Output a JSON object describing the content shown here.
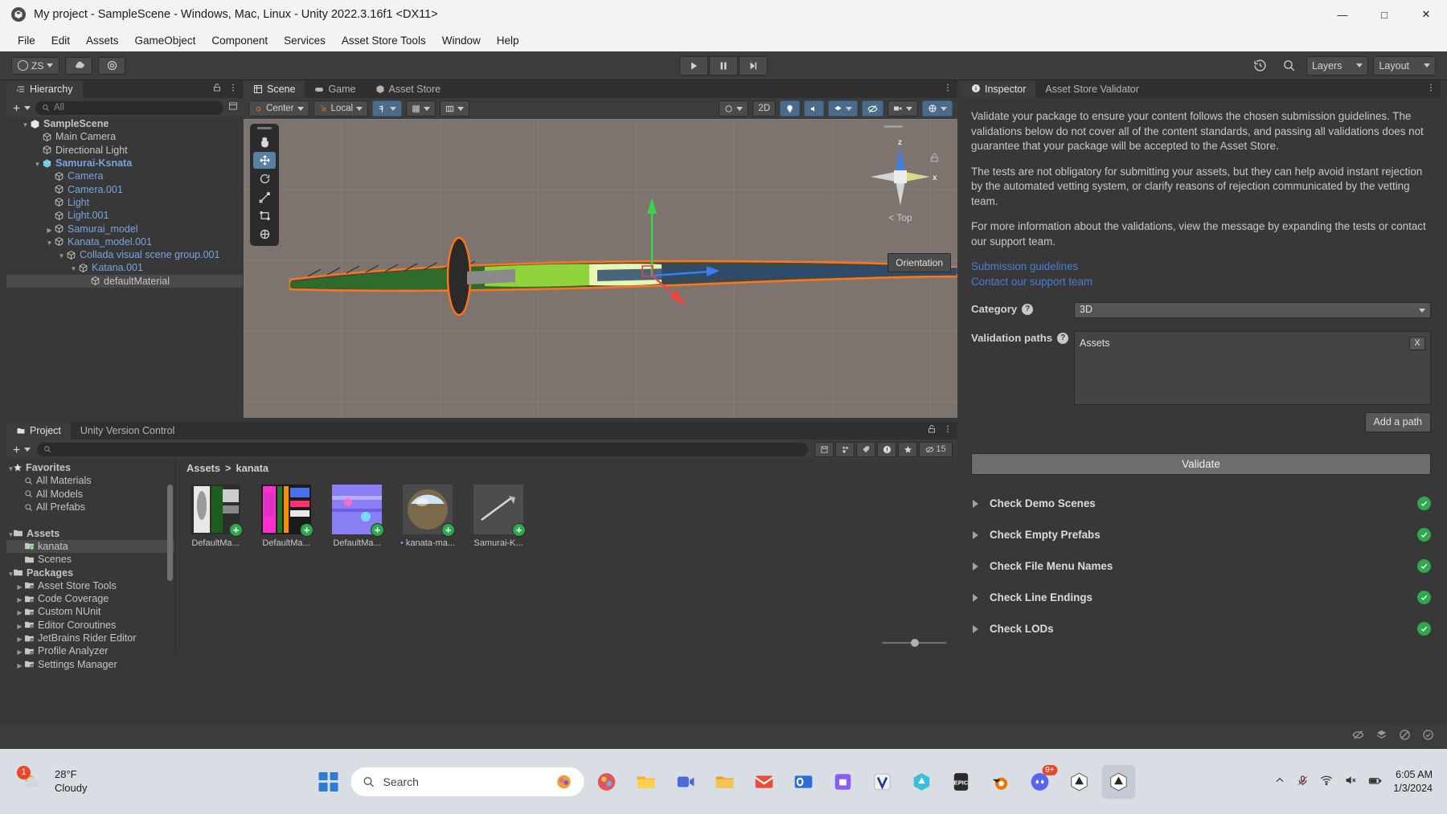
{
  "window": {
    "title": "My project - SampleScene - Windows, Mac, Linux - Unity 2022.3.16f1 <DX11>",
    "minimize": "—",
    "maximize": "□",
    "close": "✕"
  },
  "menubar": {
    "items": [
      "File",
      "Edit",
      "Assets",
      "GameObject",
      "Component",
      "Services",
      "Asset Store Tools",
      "Window",
      "Help"
    ]
  },
  "toolbar": {
    "account": "ZS",
    "layers_label": "Layers",
    "layout_label": "Layout"
  },
  "hierarchy": {
    "tab": "Hierarchy",
    "search_placeholder": "All",
    "rows": [
      {
        "label": "SampleScene",
        "depth": 1,
        "tri": "down",
        "bold": true,
        "blue": false,
        "selected": false
      },
      {
        "label": "Main Camera",
        "depth": 2,
        "tri": "",
        "bold": false,
        "blue": false,
        "selected": false
      },
      {
        "label": "Directional Light",
        "depth": 2,
        "tri": "",
        "bold": false,
        "blue": false,
        "selected": false
      },
      {
        "label": "Samurai-Ksnata",
        "depth": 2,
        "tri": "down",
        "bold": true,
        "blue": true,
        "selected": false
      },
      {
        "label": "Camera",
        "depth": 3,
        "tri": "",
        "bold": false,
        "blue": true,
        "selected": false
      },
      {
        "label": "Camera.001",
        "depth": 3,
        "tri": "",
        "bold": false,
        "blue": true,
        "selected": false
      },
      {
        "label": "Light",
        "depth": 3,
        "tri": "",
        "bold": false,
        "blue": true,
        "selected": false
      },
      {
        "label": "Light.001",
        "depth": 3,
        "tri": "",
        "bold": false,
        "blue": true,
        "selected": false
      },
      {
        "label": "Samurai_model",
        "depth": 3,
        "tri": "right",
        "bold": false,
        "blue": true,
        "selected": false
      },
      {
        "label": "Kanata_model.001",
        "depth": 3,
        "tri": "down",
        "bold": false,
        "blue": true,
        "selected": false
      },
      {
        "label": "Collada visual scene group.001",
        "depth": 4,
        "tri": "down",
        "bold": false,
        "blue": true,
        "selected": false
      },
      {
        "label": "Katana.001",
        "depth": 5,
        "tri": "down",
        "bold": false,
        "blue": true,
        "selected": false
      },
      {
        "label": "defaultMaterial",
        "depth": 6,
        "tri": "",
        "bold": false,
        "blue": false,
        "selected": true
      }
    ]
  },
  "scene": {
    "tabs": [
      {
        "label": "Scene",
        "active": true
      },
      {
        "label": "Game",
        "active": false
      },
      {
        "label": "Asset Store",
        "active": false
      }
    ],
    "pivot_mode": "Center",
    "pivot_rotation": "Local",
    "view_2d": "2D",
    "gizmo_axis_z": "z",
    "gizmo_axis_x": "x",
    "gizmo_view_label": "Top",
    "orientation_tooltip": "Orientation"
  },
  "inspector": {
    "tabs": [
      {
        "label": "Inspector",
        "active": true
      },
      {
        "label": "Asset Store Validator",
        "active": false
      }
    ],
    "paragraphs": [
      "Validate your package to ensure your content follows the chosen submission guidelines. The validations below do not cover all of the content standards, and passing all validations does not guarantee that your package will be accepted to the Asset Store.",
      "The tests are not obligatory for submitting your assets, but they can help avoid instant rejection by the automated vetting system, or clarify reasons of rejection communicated by the vetting team.",
      "For more information about the validations, view the message by expanding the tests or contact our support team."
    ],
    "links": [
      "Submission guidelines",
      "Contact our support team"
    ],
    "category_label": "Category",
    "category_value": "3D",
    "validation_paths_label": "Validation paths",
    "validation_path_value": "Assets",
    "remove_path_label": "X",
    "add_path_label": "Add a path",
    "validate_label": "Validate",
    "checks": [
      {
        "label": "Check Demo Scenes",
        "status": "pass"
      },
      {
        "label": "Check Empty Prefabs",
        "status": "pass"
      },
      {
        "label": "Check File Menu Names",
        "status": "pass"
      },
      {
        "label": "Check Line Endings",
        "status": "pass"
      },
      {
        "label": "Check LODs",
        "status": "pass"
      }
    ],
    "tick_glyph": "✓"
  },
  "project": {
    "tabs": [
      {
        "label": "Project",
        "active": true
      },
      {
        "label": "Unity Version Control",
        "active": false
      }
    ],
    "hidden_count": "15",
    "breadcrumb": [
      "Assets",
      "kanata"
    ],
    "tree": [
      {
        "label": "Favorites",
        "depth": 0,
        "tri": "down",
        "bold": true,
        "icon": "star",
        "selected": false
      },
      {
        "label": "All Materials",
        "depth": 1,
        "tri": "",
        "bold": false,
        "icon": "search",
        "selected": false
      },
      {
        "label": "All Models",
        "depth": 1,
        "tri": "",
        "bold": false,
        "icon": "search",
        "selected": false
      },
      {
        "label": "All Prefabs",
        "depth": 1,
        "tri": "",
        "bold": false,
        "icon": "search",
        "selected": false
      },
      {
        "label": "",
        "depth": 0,
        "tri": "",
        "bold": false,
        "icon": "",
        "selected": false
      },
      {
        "label": "Assets",
        "depth": 0,
        "tri": "down",
        "bold": true,
        "icon": "folder",
        "selected": false
      },
      {
        "label": "kanata",
        "depth": 1,
        "tri": "",
        "bold": false,
        "icon": "folder-add",
        "selected": true
      },
      {
        "label": "Scenes",
        "depth": 1,
        "tri": "",
        "bold": false,
        "icon": "folder",
        "selected": false
      },
      {
        "label": "Packages",
        "depth": 0,
        "tri": "down",
        "bold": true,
        "icon": "folder",
        "selected": false
      },
      {
        "label": "Asset Store Tools",
        "depth": 1,
        "tri": "right",
        "bold": false,
        "icon": "folder-pkg",
        "selected": false
      },
      {
        "label": "Code Coverage",
        "depth": 1,
        "tri": "right",
        "bold": false,
        "icon": "folder-pkg",
        "selected": false
      },
      {
        "label": "Custom NUnit",
        "depth": 1,
        "tri": "right",
        "bold": false,
        "icon": "folder-pkg",
        "selected": false
      },
      {
        "label": "Editor Coroutines",
        "depth": 1,
        "tri": "right",
        "bold": false,
        "icon": "folder-pkg",
        "selected": false
      },
      {
        "label": "JetBrains Rider Editor",
        "depth": 1,
        "tri": "right",
        "bold": false,
        "icon": "folder-pkg",
        "selected": false
      },
      {
        "label": "Profile Analyzer",
        "depth": 1,
        "tri": "right",
        "bold": false,
        "icon": "folder-pkg",
        "selected": false
      },
      {
        "label": "Settings Manager",
        "depth": 1,
        "tri": "right",
        "bold": false,
        "icon": "folder-pkg",
        "selected": false
      }
    ],
    "assets": [
      {
        "name": "DefaultMa...",
        "kind": "material-a"
      },
      {
        "name": "DefaultMa...",
        "kind": "material-b"
      },
      {
        "name": "DefaultMa...",
        "kind": "material-c"
      },
      {
        "name": "kanata-ma...",
        "kind": "material-sphere",
        "modified": true
      },
      {
        "name": "Samurai-K...",
        "kind": "model"
      }
    ]
  },
  "taskbar": {
    "weather_temp": "28°F",
    "weather_desc": "Cloudy",
    "weather_count": "1",
    "search_placeholder": "Search",
    "discord_badge": "9+",
    "time": "6:05 AM",
    "date": "1/3/2024"
  }
}
